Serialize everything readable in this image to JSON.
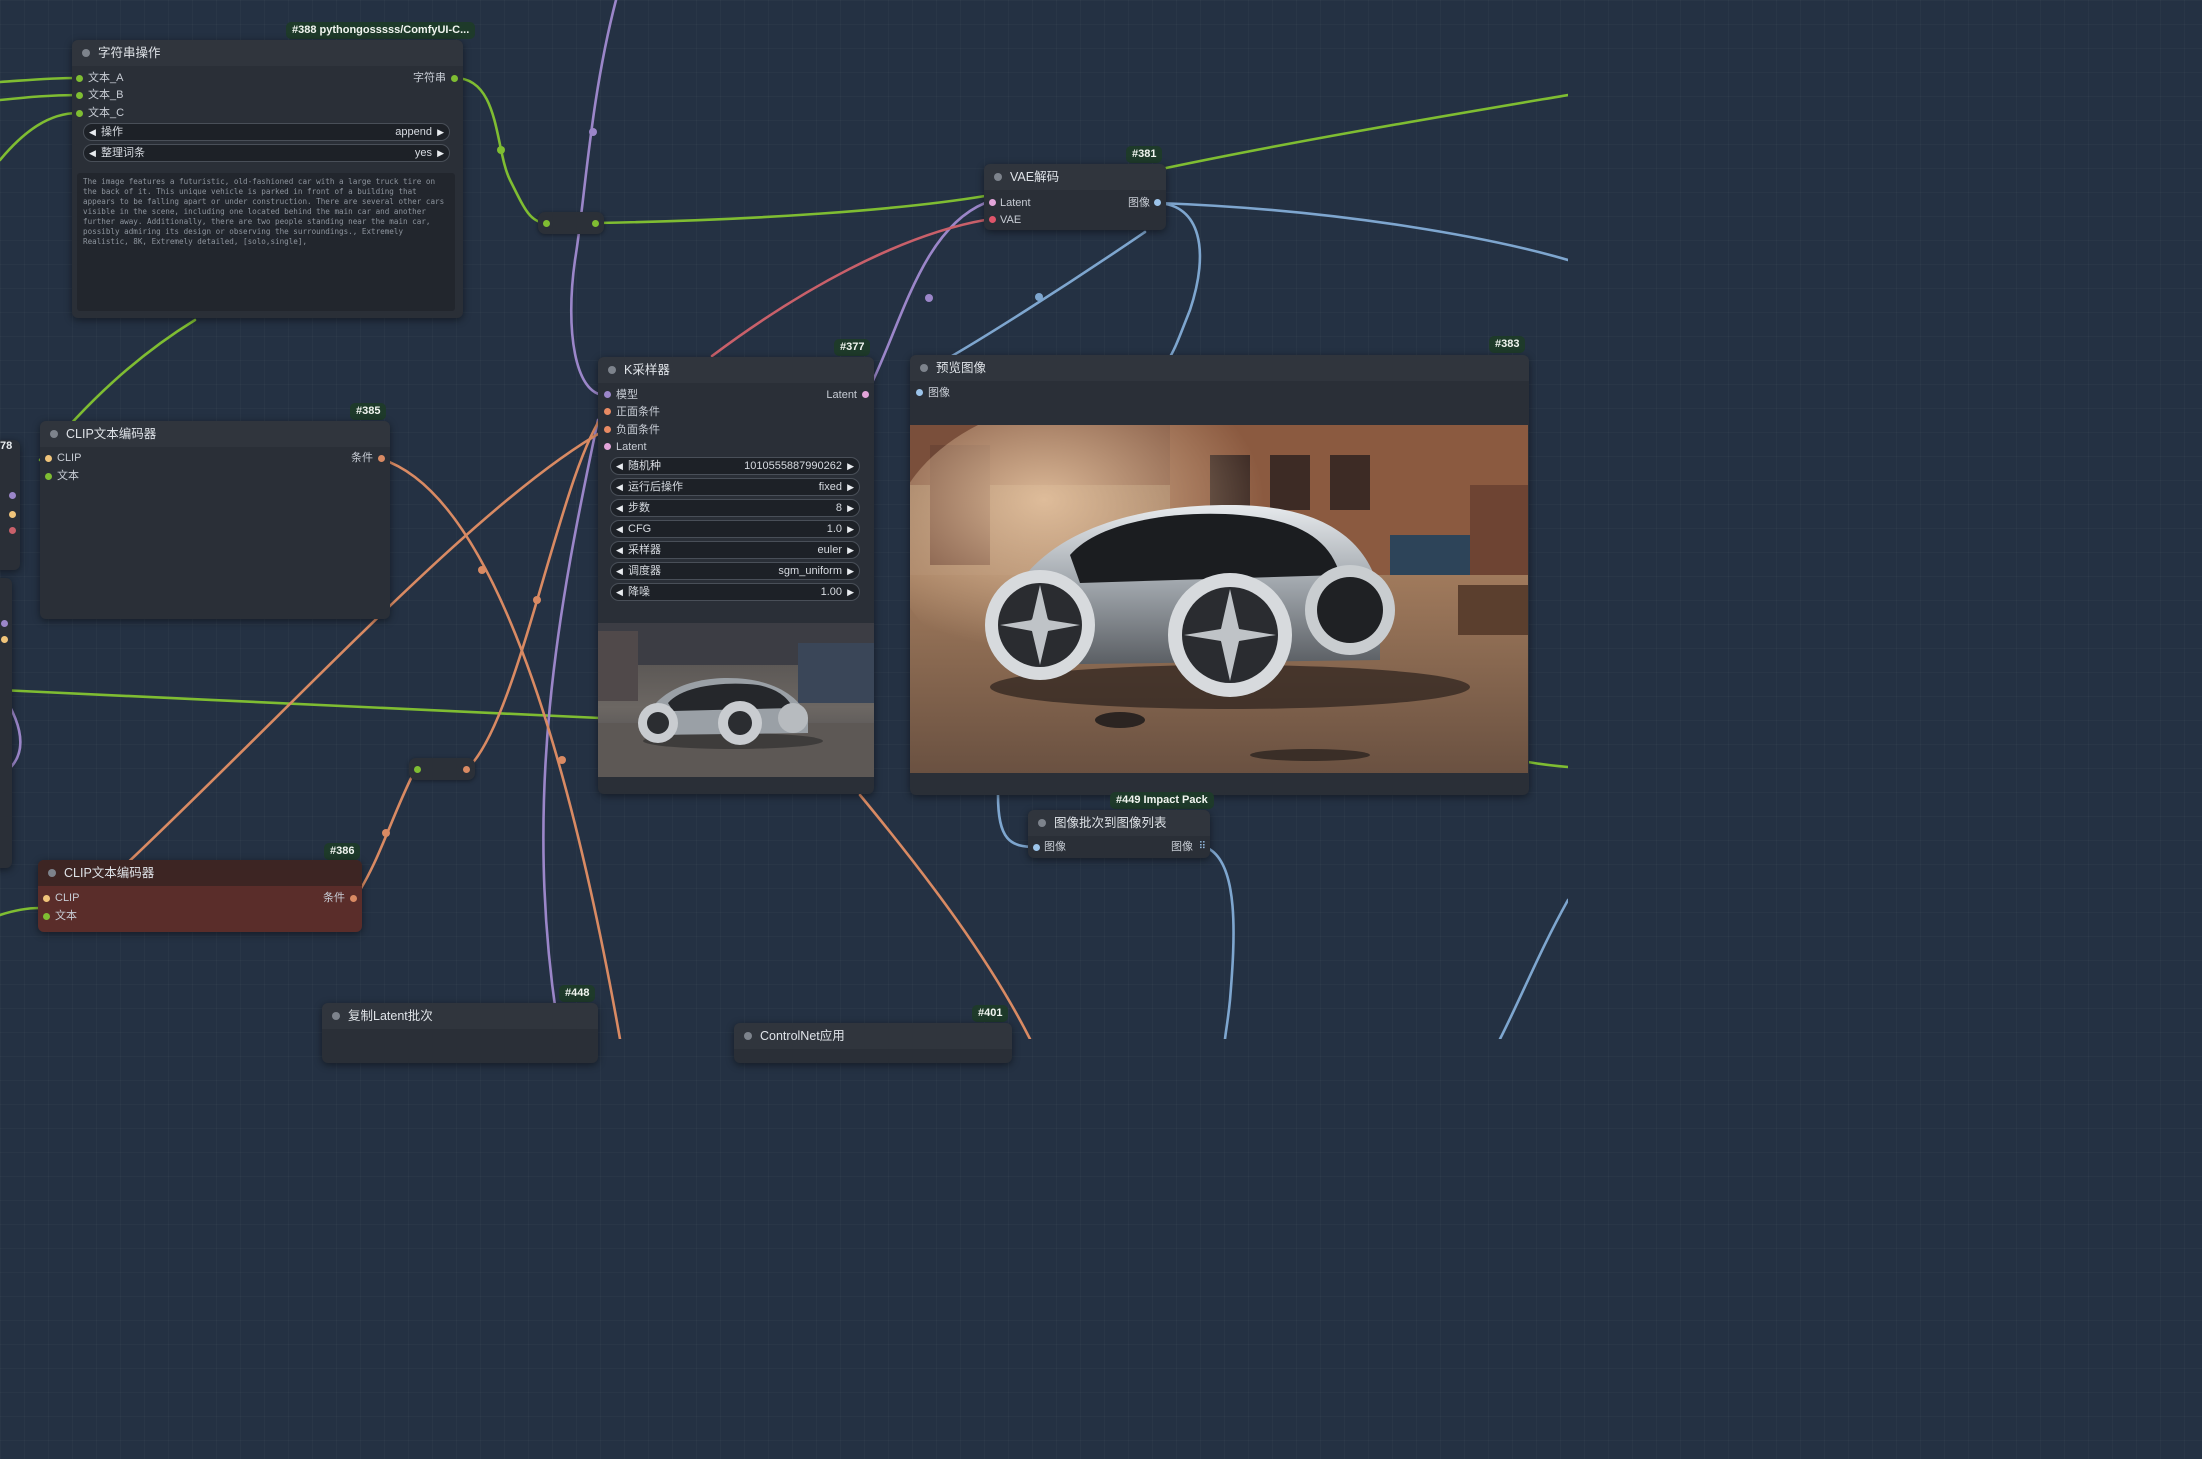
{
  "colors": {
    "canvas": "#243143",
    "node": "#2a2f37",
    "green_wire": "#7fbd32",
    "purple_wire": "#9b86c9",
    "orange_wire": "#d98a63",
    "red_wire": "#c9606a",
    "blue_wire": "#7ea6cf"
  },
  "nodes": {
    "string_op": {
      "badge": "#388 pythongosssss/ComfyUI-C...",
      "title": "字符串操作",
      "inputs": [
        "文本_A",
        "文本_B",
        "文本_C"
      ],
      "output": "字符串",
      "widgets": [
        {
          "label": "操作",
          "value": "append"
        },
        {
          "label": "整理词条",
          "value": "yes"
        }
      ],
      "text": "The image features a futuristic, old-fashioned car with a large truck tire on the back of it. This unique vehicle is parked in front of a building that appears to be falling apart or under construction. There are several other cars visible in the scene, including one located behind the main car and another further away. Additionally, there are two people standing near the main car, possibly admiring its design or observing the surroundings., Extremely Realistic, 8K, Extremely detailed, [solo,single],"
    },
    "clip385": {
      "badge": "#385",
      "title": "CLIP文本编码器",
      "inputs": [
        "CLIP",
        "文本"
      ],
      "output": "条件"
    },
    "clip386": {
      "badge": "#386",
      "title": "CLIP文本编码器",
      "inputs": [
        "CLIP",
        "文本"
      ],
      "output": "条件"
    },
    "vae381": {
      "badge": "#381",
      "title": "VAE解码",
      "inputs": [
        "Latent",
        "VAE"
      ],
      "output": "图像"
    },
    "ksampler377": {
      "badge": "#377",
      "title": "K采样器",
      "inputs": [
        "模型",
        "正面条件",
        "负面条件",
        "Latent"
      ],
      "output": "Latent",
      "widgets": [
        {
          "label": "随机种",
          "value": "1010555887990262"
        },
        {
          "label": "运行后操作",
          "value": "fixed"
        },
        {
          "label": "步数",
          "value": "8"
        },
        {
          "label": "CFG",
          "value": "1.0"
        },
        {
          "label": "采样器",
          "value": "euler"
        },
        {
          "label": "调度器",
          "value": "sgm_uniform"
        },
        {
          "label": "降噪",
          "value": "1.00"
        }
      ]
    },
    "preview383": {
      "badge": "#383",
      "title": "预览图像",
      "input": "图像"
    },
    "batch449": {
      "badge": "#449 Impact Pack",
      "title": "图像批次到图像列表",
      "input": "图像",
      "output": "图像"
    },
    "latent448": {
      "badge": "#448",
      "title": "复制Latent批次"
    },
    "controlnet401": {
      "badge": "#401",
      "title": "ControlNet应用"
    }
  },
  "edge_labels": {
    "left_78": "78"
  }
}
